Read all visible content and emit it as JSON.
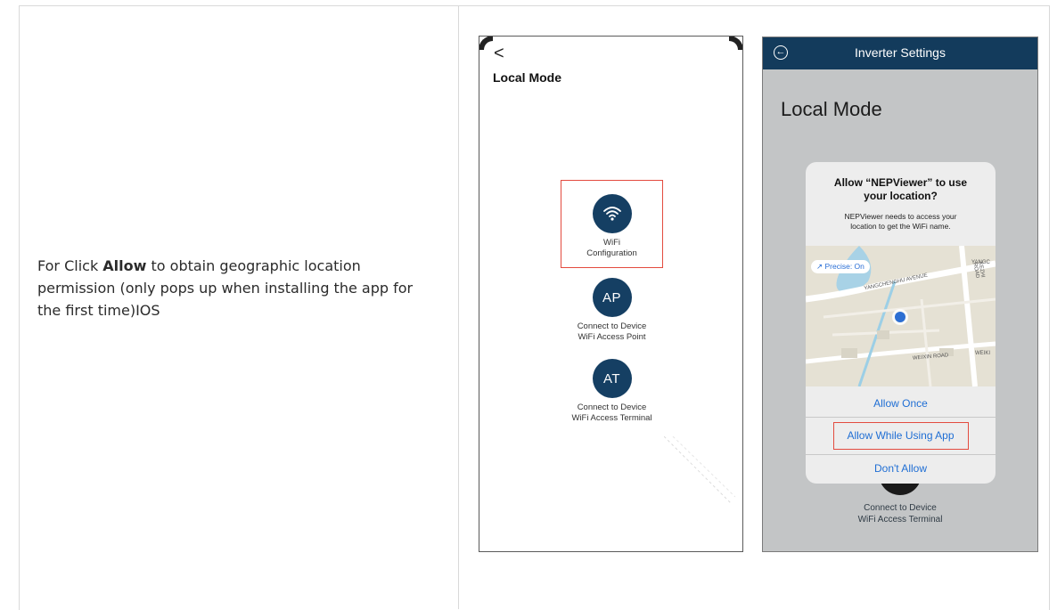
{
  "instruction": {
    "prefix": "For Click ",
    "bold_word": "Allow",
    "suffix": " to obtain geographic location permission (only pops up when installing the app for the first time)IOS"
  },
  "phone_left": {
    "back_glyph": "<",
    "title": "Local Mode",
    "options": [
      {
        "icon": "wifi-icon",
        "badge": "",
        "label_line1": "WiFi",
        "label_line2": "Configuration"
      },
      {
        "icon": "ap-badge",
        "badge": "AP",
        "label_line1": "Connect to Device",
        "label_line2": "WiFi Access Point"
      },
      {
        "icon": "at-badge",
        "badge": "AT",
        "label_line1": "Connect to Device",
        "label_line2": "WiFi Access Terminal"
      }
    ],
    "accent_color": "#153f63",
    "highlight_color": "#e34b3f"
  },
  "phone_right": {
    "header_title": "Inverter Settings",
    "page_title": "Local Mode",
    "dialog": {
      "title_line1": "Allow “NEPViewer” to use",
      "title_line2": "your location?",
      "message_line1": "NEPViewer needs to access your",
      "message_line2": "location to get the WiFi name.",
      "precise_label": "↗ Precise: On",
      "map_labels": [
        "YANGCHENGHU AVENUE",
        "KEZHI ROAD",
        "WEIXIN ROAD",
        "YANGC",
        "WEIKI"
      ],
      "buttons": [
        "Allow Once",
        "Allow While Using App",
        "Don't Allow"
      ]
    },
    "background_option": {
      "label_line1": "Connect to Device",
      "label_line2": "WiFi Access Terminal"
    },
    "header_color": "#133b5c",
    "link_color": "#1f6ed4"
  }
}
